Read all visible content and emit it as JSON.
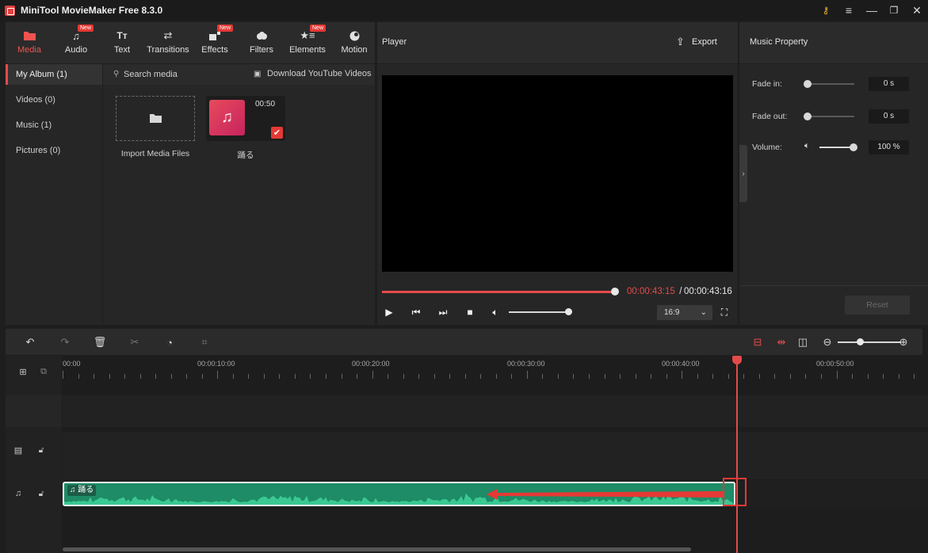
{
  "app": {
    "title": "MiniTool MovieMaker Free 8.3.0"
  },
  "window_controls": {
    "key": "key-icon",
    "menu": "≡",
    "minimize": "—",
    "maximize": "❐",
    "close": "✕"
  },
  "media_toolbar": {
    "tools": [
      {
        "label": "Media",
        "icon": "folder-icon",
        "active": true,
        "new": false
      },
      {
        "label": "Audio",
        "icon": "music-note-icon",
        "active": false,
        "new": true
      },
      {
        "label": "Text",
        "icon": "text-icon",
        "active": false,
        "new": false
      },
      {
        "label": "Transitions",
        "icon": "swap-arrows-icon",
        "active": false,
        "new": false
      },
      {
        "label": "Effects",
        "icon": "effects-icon",
        "active": false,
        "new": true
      },
      {
        "label": "Filters",
        "icon": "filters-icon",
        "active": false,
        "new": false
      },
      {
        "label": "Elements",
        "icon": "elements-icon",
        "active": false,
        "new": true
      },
      {
        "label": "Motion",
        "icon": "motion-icon",
        "active": false,
        "new": false
      }
    ],
    "new_badge": "New"
  },
  "album_sidebar": {
    "items": [
      "My Album (1)",
      "Videos (0)",
      "Music (1)",
      "Pictures (0)"
    ]
  },
  "media_area": {
    "search_placeholder": "Search media",
    "download_label": "Download YouTube Videos",
    "import_label": "Import Media Files",
    "media_item": {
      "name": "踊る",
      "duration": "00:50",
      "selected": true
    }
  },
  "player": {
    "title": "Player",
    "export_label": "Export",
    "current_time": "00:00:43:15",
    "separator": " / ",
    "total_time": "00:00:43:16",
    "progress_fraction": 0.99,
    "aspect_ratio": "16:9"
  },
  "music_property": {
    "title": "Music Property",
    "fade_in": {
      "label": "Fade in:",
      "value": "0 s"
    },
    "fade_out": {
      "label": "Fade out:",
      "value": "0 s"
    },
    "volume": {
      "label": "Volume:",
      "value": "100 %"
    },
    "reset_label": "Reset"
  },
  "timeline": {
    "ruler_labels": [
      "00:00",
      "00:00:10:00",
      "00:00:20:00",
      "00:00:30:00",
      "00:00:40:00",
      "00:00:50:00"
    ],
    "audio_clip_label": "踊る",
    "zoom_minus": "−",
    "zoom_plus": "+"
  },
  "colors": {
    "accent": "#e54a4a",
    "audio_clip": "#1e8c66",
    "background": "#1e1e1e"
  }
}
